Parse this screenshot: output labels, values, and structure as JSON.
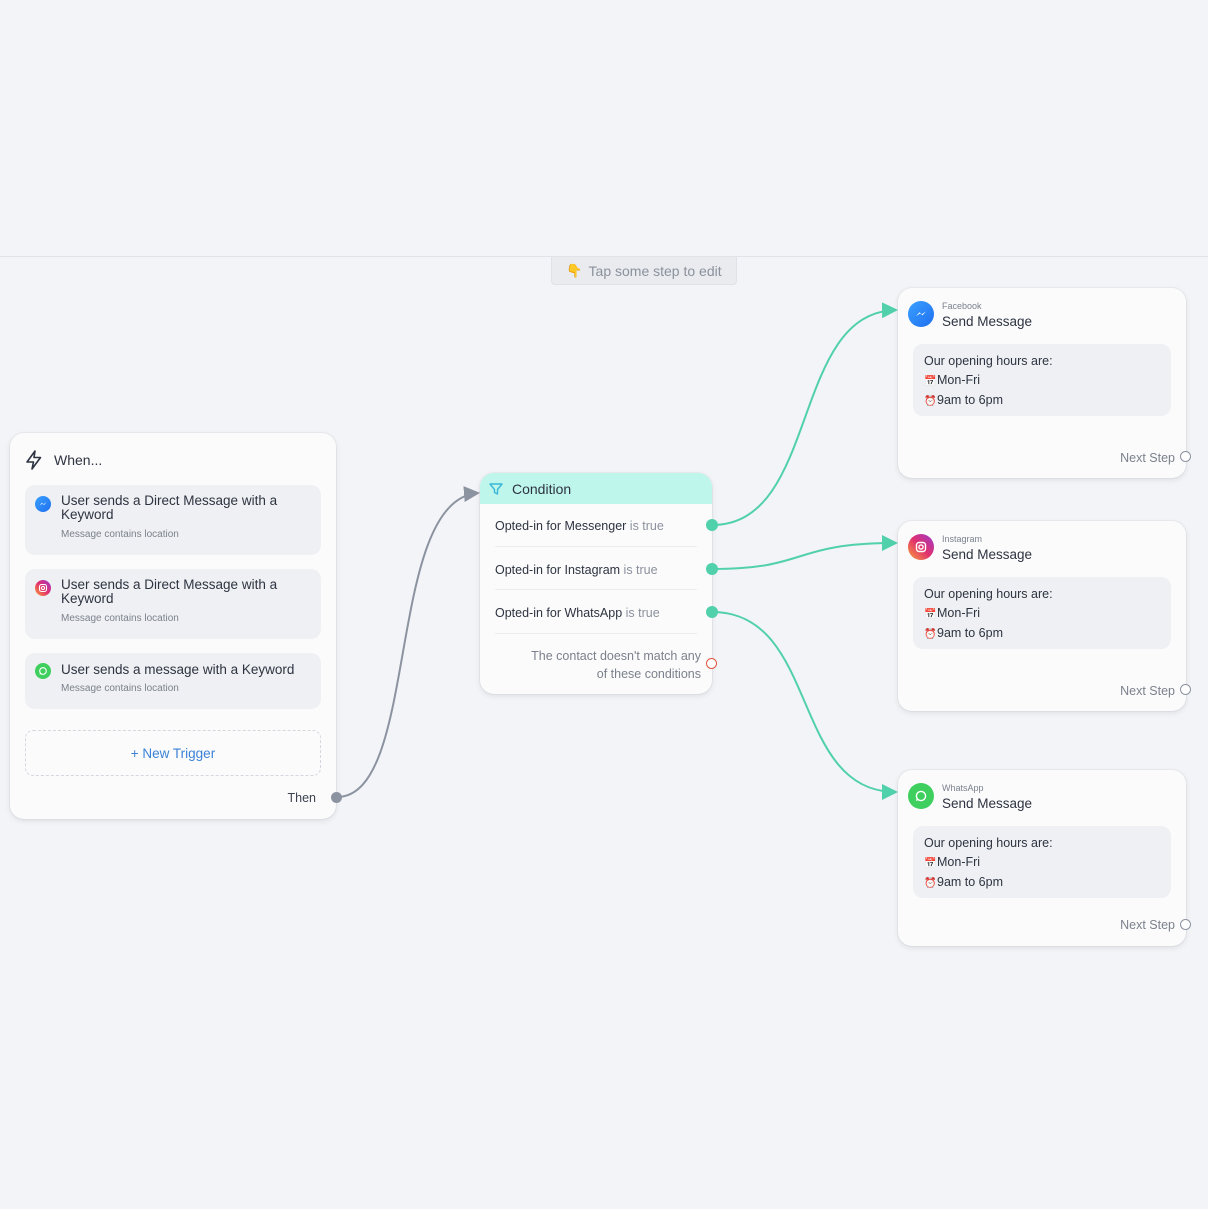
{
  "hint": {
    "icon": "pointing-hand-icon",
    "text": "Tap some step to edit"
  },
  "trigger": {
    "title": "When...",
    "items": [
      {
        "platform": "Messenger",
        "icon": "messenger-icon",
        "title": "User sends a Direct Message with a Keyword",
        "subtitle": "Message contains location"
      },
      {
        "platform": "Instagram",
        "icon": "instagram-icon",
        "title": "User sends a Direct Message with a Keyword",
        "subtitle": "Message contains location"
      },
      {
        "platform": "WhatsApp",
        "icon": "whatsapp-icon",
        "title": "User sends a message with a Keyword",
        "subtitle": "Message contains location"
      }
    ],
    "new_trigger": "+ New Trigger",
    "then": "Then"
  },
  "condition": {
    "title": "Condition",
    "rows": [
      {
        "label": "Opted-in for Messenger",
        "state": "is true"
      },
      {
        "label": "Opted-in for Instagram",
        "state": "is true"
      },
      {
        "label": "Opted-in for WhatsApp",
        "state": "is true"
      }
    ],
    "else_line1": "The contact doesn't match any",
    "else_line2": "of these conditions"
  },
  "messages": [
    {
      "platform": "Facebook",
      "title": "Send Message",
      "line1": "Our opening hours are:",
      "line2": "Mon-Fri",
      "line3": "9am to 6pm",
      "next": "Next Step"
    },
    {
      "platform": "Instagram",
      "title": "Send Message",
      "line1": "Our opening hours are:",
      "line2": "Mon-Fri",
      "line3": "9am to 6pm",
      "next": "Next Step"
    },
    {
      "platform": "WhatsApp",
      "title": "Send Message",
      "line1": "Our opening hours are:",
      "line2": "Mon-Fri",
      "line3": "9am to 6pm",
      "next": "Next Step"
    }
  ],
  "colors": {
    "connector_green": "#51d0ac",
    "connector_gray": "#8c93a0",
    "condition_header": "#bff6ec",
    "link_blue": "#3b82d6",
    "else_port": "#e0533d"
  }
}
